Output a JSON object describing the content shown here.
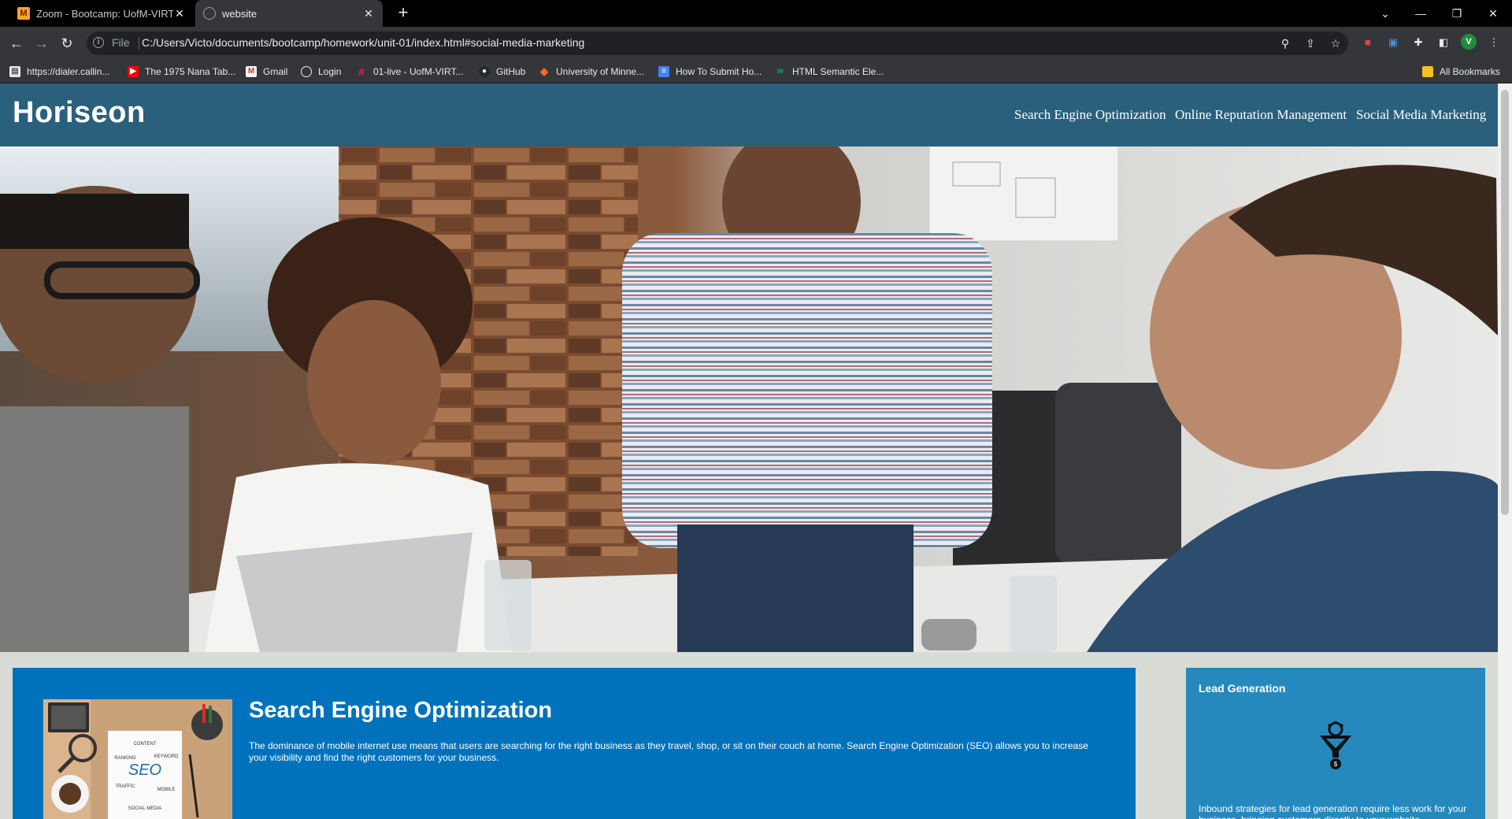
{
  "browser": {
    "tabs": [
      {
        "title": "Zoom - Bootcamp: UofM-VIRT-F",
        "icon": "zoom-icon",
        "active": false
      },
      {
        "title": "website",
        "icon": "globe-icon",
        "active": true
      }
    ],
    "address": {
      "scheme": "File",
      "url": "C:/Users/Victo/documents/bootcamp/homework/unit-01/index.html#social-media-marketing"
    },
    "profile_initial": "V",
    "bookmarks": [
      {
        "label": "https://dialer.callin...",
        "icon": "page-icon"
      },
      {
        "label": "The 1975 Nana Tab...",
        "icon": "youtube-icon"
      },
      {
        "label": "Gmail",
        "icon": "gmail-icon"
      },
      {
        "label": "Login",
        "icon": "login-globe-icon"
      },
      {
        "label": "01-live - UofM-VIRT...",
        "icon": "slack-icon"
      },
      {
        "label": "GitHub",
        "icon": "github-icon"
      },
      {
        "label": "University of Minne...",
        "icon": "gitlab-icon"
      },
      {
        "label": "How To Submit Ho...",
        "icon": "docs-icon"
      },
      {
        "label": "HTML Semantic Ele...",
        "icon": "w3schools-icon"
      }
    ],
    "all_bookmarks": "All Bookmarks"
  },
  "site": {
    "logo": "Horiseon",
    "nav": [
      "Search Engine Optimization",
      "Online Reputation Management",
      "Social Media Marketing"
    ],
    "colors": {
      "header": "#2a607c",
      "seo_card": "#0072bb",
      "sidebar_card": "#2589bd",
      "page_bg": "#d9dcd6"
    },
    "seo": {
      "title": "Search Engine Optimization",
      "text": "The dominance of mobile internet use means that users are searching for the right business as they travel, shop, or sit on their couch at home. Search Engine Optimization (SEO) allows you to increase your visibility and find the right customers for your business.",
      "image_words": [
        "SEO",
        "CONTENT",
        "RANKING",
        "KEYWORD",
        "TRAFFIC",
        "MOBILE",
        "SOCIAL MEDIA"
      ]
    },
    "lead": {
      "title": "Lead Generation",
      "text": "Inbound strategies for lead generation require less work for your business, bringing customers directly to your website."
    }
  }
}
